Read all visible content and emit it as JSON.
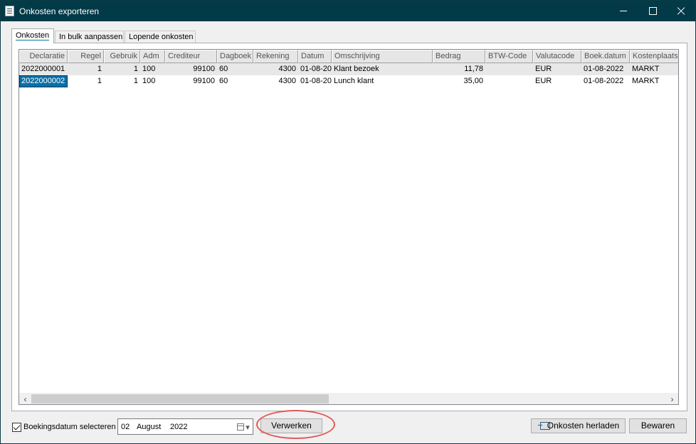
{
  "window": {
    "title": "Onkosten exporteren"
  },
  "tabs": [
    "Onkosten",
    "In bulk aanpassen",
    "Lopende onkosten"
  ],
  "grid": {
    "columns": [
      "Declaratie",
      "Regel",
      "Gebruik",
      "Adm",
      "Crediteur",
      "Dagboek",
      "Rekening",
      "Datum",
      "Omschrijving",
      "Bedrag",
      "BTW-Code",
      "Valutacode",
      "Boek.datum",
      "Kostenplaats"
    ],
    "rows": [
      [
        "2022000001",
        "1",
        "1",
        "100",
        "99100",
        "60",
        "4300",
        "01-08-20",
        "Klant bezoek",
        "11,78",
        "",
        "EUR",
        "01-08-2022",
        "MARKT"
      ],
      [
        "2022000002",
        "1",
        "1",
        "100",
        "99100",
        "60",
        "4300",
        "01-08-20",
        "Lunch klant",
        "35,00",
        "",
        "EUR",
        "01-08-2022",
        "MARKT"
      ]
    ]
  },
  "footer": {
    "checkbox_label": "Boekingsdatum selecteren",
    "date": {
      "day": "02",
      "month": "August",
      "year": "2022"
    },
    "process_button": "Verwerken",
    "reload_button": "Onkosten herladen",
    "save_button": "Bewaren"
  }
}
